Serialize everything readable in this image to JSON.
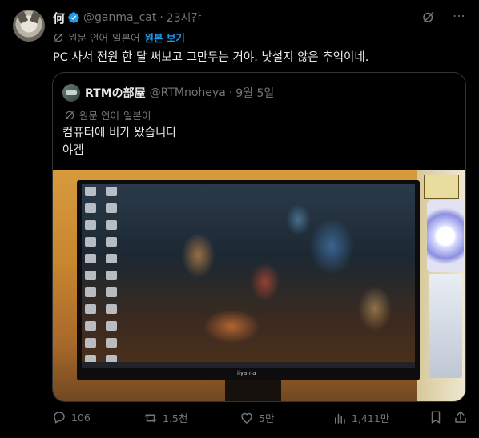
{
  "author": {
    "display_name": "何",
    "handle": "@ganma_cat",
    "separator": "·",
    "time": "23시간"
  },
  "translation": {
    "label": "원문 언어",
    "language": "일본어",
    "show_original": "원본 보기"
  },
  "tweet": {
    "text": "PC 사서 전원 한 달 써보고 그만두는 거야. 낯설지 않은 추억이네."
  },
  "quote": {
    "display_name": "RTMの部屋",
    "handle": "@RTMnoheya",
    "separator": "·",
    "time": "9월 5일",
    "translation_label": "원문 언어",
    "translation_language": "일본어",
    "text_line1": "컴퓨터에 비가 왔습니다",
    "text_line2": "야겜",
    "monitor_brand": "iiyama"
  },
  "actions": {
    "replies": "106",
    "retweets": "1.5천",
    "likes": "5만",
    "views": "1,411만"
  },
  "colors": {
    "background": "#000000",
    "text": "#e7e9ea",
    "muted": "#71767b",
    "accent": "#1d9bf0",
    "border": "#2f3336"
  },
  "icons": {
    "verified": "verified-badge-icon",
    "grok": "grok-icon",
    "more": "more-icon",
    "translate": "translate-icon",
    "reply": "reply-icon",
    "retweet": "retweet-icon",
    "like": "like-icon",
    "views": "views-icon",
    "bookmark": "bookmark-icon",
    "share": "share-icon"
  }
}
